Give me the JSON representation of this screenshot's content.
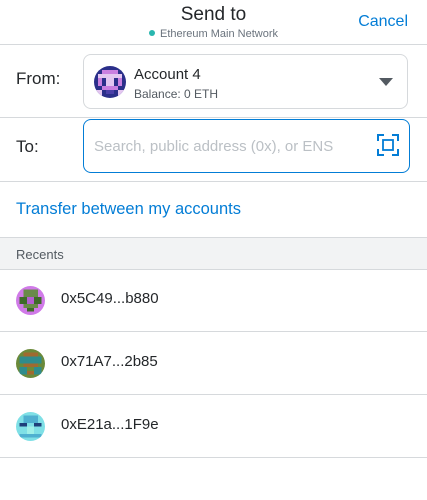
{
  "header": {
    "title": "Send to",
    "network": "Ethereum Main Network",
    "cancel_label": "Cancel"
  },
  "from": {
    "label": "From:",
    "account_name": "Account 4",
    "balance": "Balance: 0 ETH"
  },
  "to": {
    "label": "To:",
    "value": "",
    "placeholder": "Search, public address (0x), or ENS"
  },
  "transfer_link": "Transfer between my accounts",
  "recents": {
    "header": "Recents",
    "items": [
      {
        "address": "0x5C49...b880"
      },
      {
        "address": "0x71A7...2b85"
      },
      {
        "address": "0xE21a...1F9e"
      }
    ]
  },
  "colors": {
    "accent": "#037dd6",
    "network_dot": "#29b6af",
    "divider": "#d6d9dc"
  }
}
